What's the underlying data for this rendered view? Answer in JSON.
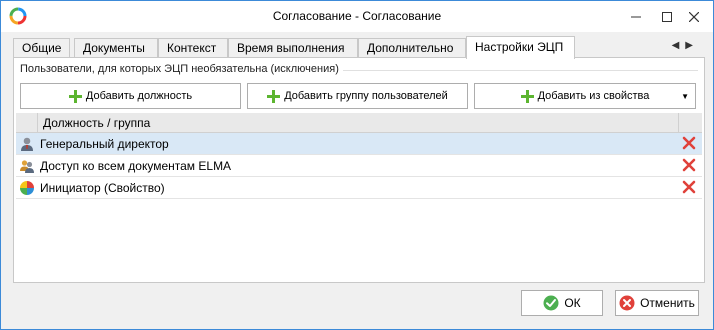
{
  "window": {
    "title": "Согласование - Согласование"
  },
  "tabs": [
    {
      "label": "Общие"
    },
    {
      "label": "Документы"
    },
    {
      "label": "Контекст"
    },
    {
      "label": "Время выполнения"
    },
    {
      "label": "Дополнительно"
    },
    {
      "label": "Настройки ЭЦП"
    }
  ],
  "active_tab": "Настройки ЭЦП",
  "panel": {
    "group_title": "Пользователи, для которых ЭЦП необязательна (исключения)",
    "buttons": {
      "add_position": "Добавить должность",
      "add_group": "Добавить группу пользователей",
      "add_from_property": "Добавить из свойства"
    },
    "grid": {
      "column_header": "Должность / группа",
      "rows": [
        {
          "text": "Генеральный директор",
          "icon": "user-icon",
          "selected": true
        },
        {
          "text": "Доступ ко всем документам ELMA",
          "icon": "user-group-icon",
          "selected": false
        },
        {
          "text": "Инициатор (Свойство)",
          "icon": "property-pie-icon",
          "selected": false
        }
      ]
    }
  },
  "footer": {
    "ok_label": "ОК",
    "cancel_label": "Отменить"
  },
  "colors": {
    "accent_border": "#3c8ad8",
    "selected_row": "#d9e8f6",
    "delete_red": "#e0413a",
    "add_green": "#5cb530"
  }
}
